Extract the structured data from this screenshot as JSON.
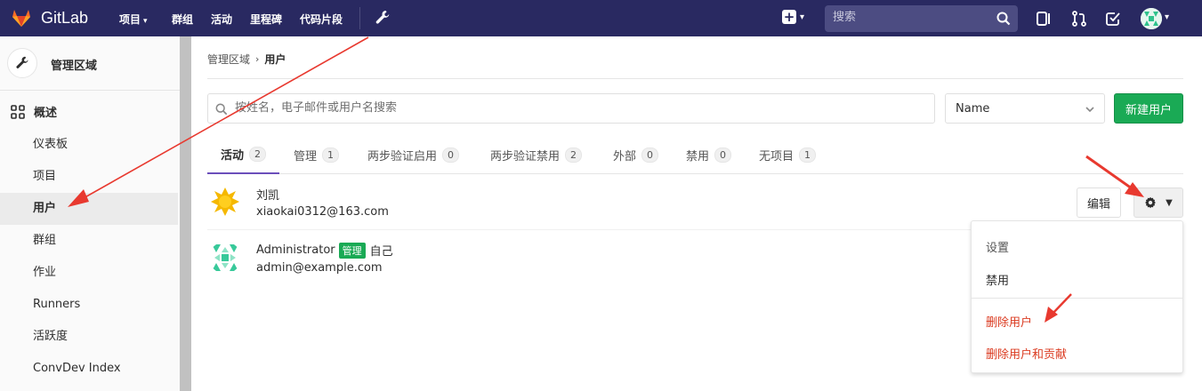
{
  "nav": {
    "brand": "GitLab",
    "items": [
      {
        "label": "项目",
        "has_caret": true
      },
      {
        "label": "群组"
      },
      {
        "label": "活动"
      },
      {
        "label": "里程碑"
      },
      {
        "label": "代码片段"
      }
    ],
    "search_placeholder": "搜索",
    "colors": {
      "bg": "#292961",
      "search_bg": "#4c4c82"
    }
  },
  "sidebar": {
    "title": "管理区域",
    "overview": "概述",
    "items": [
      {
        "label": "仪表板",
        "active": false
      },
      {
        "label": "项目",
        "active": false
      },
      {
        "label": "用户",
        "active": true
      },
      {
        "label": "群组",
        "active": false
      },
      {
        "label": "作业",
        "active": false
      },
      {
        "label": "Runners",
        "active": false
      },
      {
        "label": "活跃度",
        "active": false
      },
      {
        "label": "ConvDev Index",
        "active": false
      }
    ]
  },
  "breadcrumb": {
    "parent": "管理区域",
    "current": "用户"
  },
  "toolbar": {
    "search_placeholder": "按姓名，电子邮件或用户名搜索",
    "sort_value": "Name",
    "new_user_label": "新建用户",
    "accent": "#1aaa55"
  },
  "tabs": [
    {
      "label": "活动",
      "count": "2",
      "active": true
    },
    {
      "label": "管理",
      "count": "1"
    },
    {
      "label": "两步验证启用",
      "count": "0"
    },
    {
      "label": "两步验证禁用",
      "count": "2"
    },
    {
      "label": "外部",
      "count": "0"
    },
    {
      "label": "禁用",
      "count": "0"
    },
    {
      "label": "无项目",
      "count": "1"
    }
  ],
  "users": [
    {
      "name": "刘凯",
      "email": "xiaokai0312@163.com",
      "edit_label": "编辑"
    },
    {
      "name": "Administrator",
      "admin_badge": "管理",
      "self_label": "自己",
      "email": "admin@example.com"
    }
  ],
  "dropdown": {
    "settings": "设置",
    "block": "禁用",
    "delete_user": "删除用户",
    "delete_user_contrib": "删除用户和贡献"
  },
  "annotation_color": "#e8392f"
}
